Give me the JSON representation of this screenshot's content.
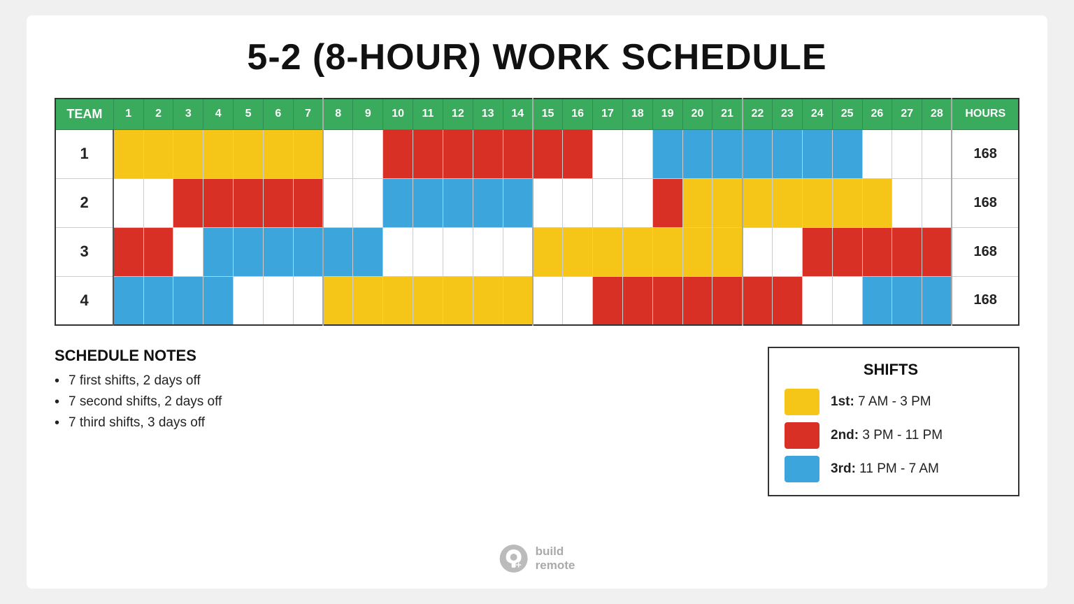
{
  "title": "5-2 (8-HOUR) WORK SCHEDULE",
  "table": {
    "team_header": "TEAM",
    "hours_header": "HOURS",
    "day_headers": [
      "1",
      "2",
      "3",
      "4",
      "5",
      "6",
      "7",
      "8",
      "9",
      "10",
      "11",
      "12",
      "13",
      "14",
      "15",
      "16",
      "17",
      "18",
      "19",
      "20",
      "21",
      "22",
      "23",
      "24",
      "25",
      "26",
      "27",
      "28"
    ],
    "rows": [
      {
        "team": "1",
        "hours": "168",
        "cells": [
          "Y",
          "Y",
          "Y",
          "Y",
          "Y",
          "Y",
          "Y",
          "W",
          "W",
          "R",
          "R",
          "R",
          "R",
          "R",
          "R",
          "R",
          "W",
          "W",
          "B",
          "B",
          "B",
          "B",
          "B",
          "B",
          "B",
          "W",
          "W",
          "W"
        ]
      },
      {
        "team": "2",
        "hours": "168",
        "cells": [
          "W",
          "W",
          "R",
          "R",
          "R",
          "R",
          "R",
          "W",
          "W",
          "B",
          "B",
          "B",
          "B",
          "B",
          "W",
          "W",
          "W",
          "W",
          "R",
          "Y",
          "Y",
          "Y",
          "Y",
          "Y",
          "Y",
          "Y",
          "W",
          "W"
        ]
      },
      {
        "team": "3",
        "hours": "168",
        "cells": [
          "R",
          "R",
          "W",
          "B",
          "B",
          "B",
          "B",
          "B",
          "B",
          "W",
          "W",
          "W",
          "W",
          "W",
          "Y",
          "Y",
          "Y",
          "Y",
          "Y",
          "Y",
          "Y",
          "W",
          "W",
          "R",
          "R",
          "R",
          "R",
          "R"
        ]
      },
      {
        "team": "4",
        "hours": "168",
        "cells": [
          "B",
          "B",
          "B",
          "B",
          "W",
          "W",
          "W",
          "Y",
          "Y",
          "Y",
          "Y",
          "Y",
          "Y",
          "Y",
          "W",
          "W",
          "R",
          "R",
          "R",
          "R",
          "R",
          "R",
          "R",
          "W",
          "W",
          "B",
          "B",
          "B"
        ]
      }
    ]
  },
  "notes": {
    "title": "SCHEDULE NOTES",
    "items": [
      "7 first shifts, 2 days off",
      "7 second shifts, 2 days off",
      "7 third shifts, 3 days off"
    ]
  },
  "legend": {
    "title": "SHIFTS",
    "items": [
      {
        "color": "#F5C518",
        "label_bold": "1st:",
        "label": " 7 AM - 3 PM"
      },
      {
        "color": "#D93025",
        "label_bold": "2nd:",
        "label": " 3 PM - 11 PM"
      },
      {
        "color": "#3CA5DC",
        "label_bold": "3rd:",
        "label": " 11 PM - 7 AM"
      }
    ]
  },
  "logo": {
    "text_line1": "build",
    "text_line2": "remote"
  },
  "colors": {
    "Y": "#F5C518",
    "R": "#D93025",
    "B": "#3CA5DC",
    "W": "#ffffff"
  }
}
